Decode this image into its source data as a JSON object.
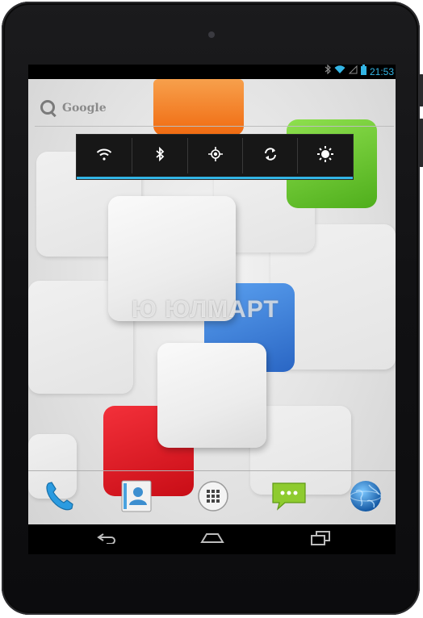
{
  "status_bar": {
    "icons": [
      "bluetooth-icon",
      "wifi-icon",
      "no-sim-icon",
      "battery-icon"
    ],
    "time": "21:53",
    "accent_color": "#33b5e5"
  },
  "search_widget": {
    "label": "Google",
    "icon": "search-icon"
  },
  "power_widget": {
    "toggles": [
      {
        "id": "wifi",
        "icon": "wifi-icon"
      },
      {
        "id": "bluetooth",
        "icon": "bluetooth-icon"
      },
      {
        "id": "gps",
        "icon": "gps-icon"
      },
      {
        "id": "sync",
        "icon": "sync-icon"
      },
      {
        "id": "brightness",
        "icon": "brightness-icon"
      }
    ],
    "indicator_color": "#33b5e5"
  },
  "watermark": {
    "text": "Ю ЮЛМАРТ"
  },
  "dock": {
    "apps": [
      {
        "id": "phone",
        "icon": "phone-icon"
      },
      {
        "id": "contacts",
        "icon": "contacts-icon"
      },
      {
        "id": "all-apps",
        "icon": "app-drawer-icon"
      },
      {
        "id": "messaging",
        "icon": "messaging-icon"
      },
      {
        "id": "browser",
        "icon": "browser-globe-icon"
      }
    ]
  },
  "nav_bar": {
    "buttons": [
      "back-icon",
      "home-icon",
      "recent-apps-icon"
    ]
  },
  "wallpaper": {
    "tile_colors": [
      "#f57c1f",
      "#62c22a",
      "#3a7fd6",
      "#e5141f"
    ]
  }
}
